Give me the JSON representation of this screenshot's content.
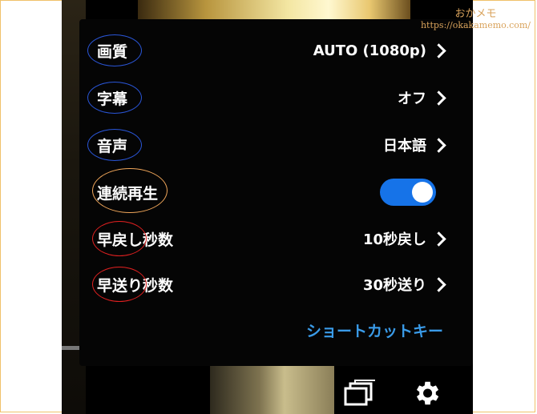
{
  "menu": {
    "rows": [
      {
        "label": "画質",
        "value": "AUTO (1080p)",
        "type": "submenu"
      },
      {
        "label": "字幕",
        "value": "オフ",
        "type": "submenu"
      },
      {
        "label": "音声",
        "value": "日本語",
        "type": "submenu"
      },
      {
        "label": "連続再生",
        "type": "toggle",
        "toggle_on": true
      },
      {
        "label": "早戻し秒数",
        "value": "10秒戻し",
        "type": "submenu"
      },
      {
        "label": "早送り秒数",
        "value": "30秒送り",
        "type": "submenu"
      }
    ],
    "shortcut_link": "ショートカットキー"
  },
  "icons": {
    "chevron": "chevron-right-icon",
    "episodes": "stacked-windows-icon",
    "settings": "gear-icon"
  },
  "annotations": {
    "blue_circle_color": "#2a56d8",
    "orange_circle_color": "#f0a65a",
    "red_circle_color": "#e02020"
  },
  "colors": {
    "toggle_on": "#1673e8",
    "link": "#3a9be8",
    "menu_bg": "#050505"
  },
  "watermark": {
    "title": "おかメモ",
    "url": "https://okakamemo.com/"
  }
}
